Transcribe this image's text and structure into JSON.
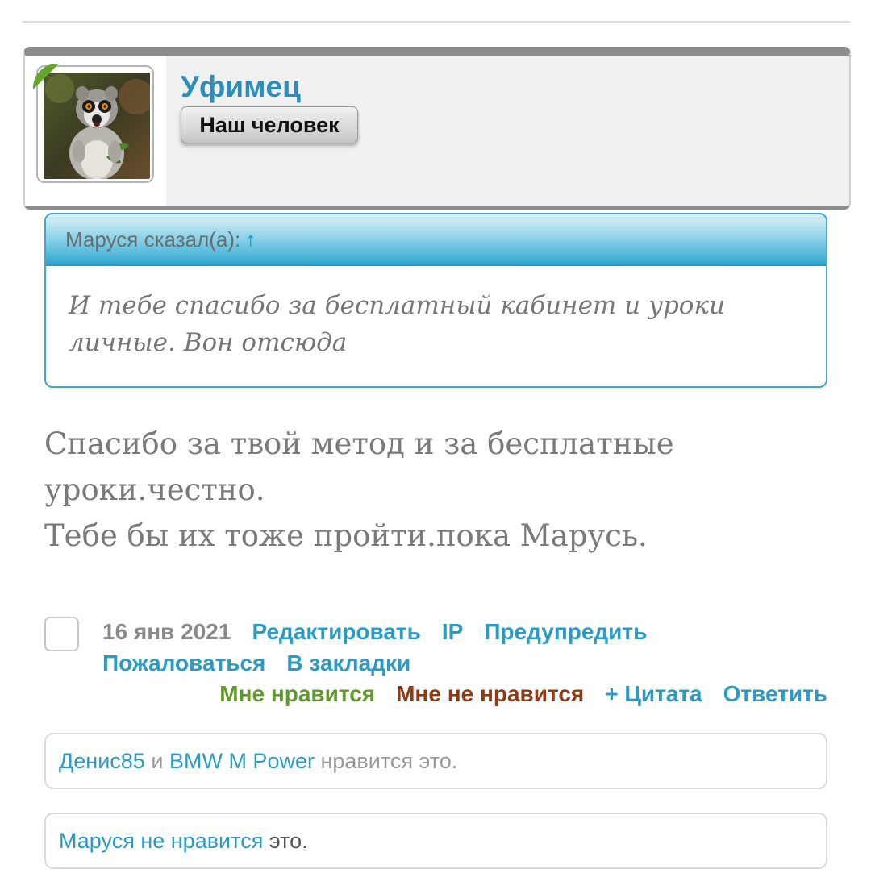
{
  "post": {
    "author": {
      "name": "Уфимец",
      "title_badge": "Наш человек",
      "avatar_icon": "lemur-avatar",
      "online_indicator_color": "#64a52c"
    },
    "quote": {
      "header": "Маруся сказал(а):",
      "jump_arrow": "↑",
      "text_line1": "И тебе спасибо за бесплатный кабинет и уроки",
      "text_line2": "личные. Вон отсюда"
    },
    "message": {
      "line1": "Спасибо за твой метод и за бесплатные",
      "line2": "уроки.честно.",
      "line3": "Тебе бы их тоже пройти.пока Марусь."
    },
    "meta": {
      "date": "16 янв 2021",
      "edit": "Редактировать",
      "ip": "IP",
      "warn": "Предупредить",
      "report": "Пожаловаться",
      "bookmark": "В закладки"
    },
    "actions": {
      "like": "Мне нравится",
      "dislike": "Мне не нравится",
      "quote": "+ Цитата",
      "reply": "Ответить"
    },
    "likes": {
      "user1": "Денис85",
      "conj": "и",
      "user2": "BMW M Power",
      "suffix": "нравится это."
    },
    "dislikes": {
      "text": "Маруся не нравится",
      "suffix": "это."
    }
  },
  "colors": {
    "link": "#2b9bc3",
    "like": "#5f9a2b",
    "dislike": "#8f3a12",
    "quote_border": "#3aa8cf"
  }
}
